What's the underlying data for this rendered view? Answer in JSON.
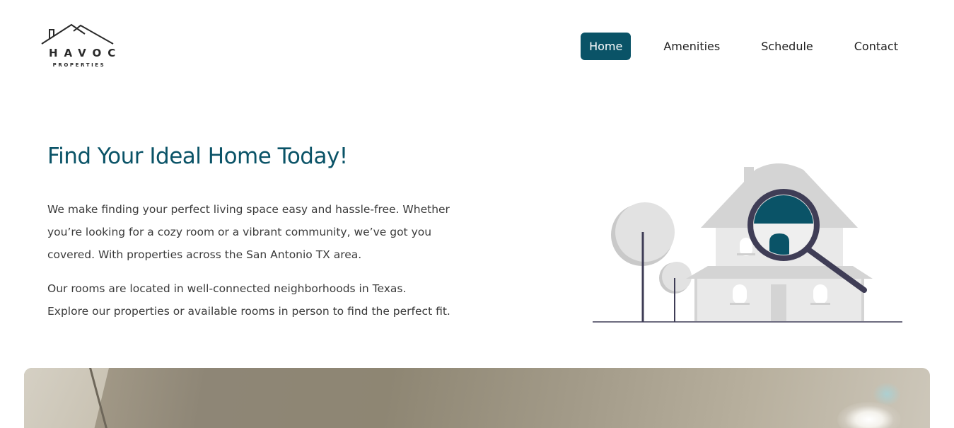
{
  "brand": {
    "name": "HAVOC",
    "subtitle": "PROPERTIES"
  },
  "nav": {
    "items": [
      {
        "label": "Home",
        "active": true
      },
      {
        "label": "Amenities",
        "active": false
      },
      {
        "label": "Schedule",
        "active": false
      },
      {
        "label": "Contact",
        "active": false
      }
    ]
  },
  "hero": {
    "title": "Find Your Ideal Home Today!",
    "paragraph_1": "We make finding your perfect living space easy and hassle-free. Whether you’re looking for a cozy room or a vibrant community, we’ve got you covered. With properties across the San Antonio TX area.",
    "paragraph_2": "Our rooms are located in well-connected neighborhoods in Texas. Explore our properties or available rooms in person to find the perfect fit."
  },
  "colors": {
    "accent": "#0a5367",
    "illustration_gray": "#d4d4d4",
    "illustration_dark": "#3f3d56"
  },
  "icons": {
    "illustration": "house-search-illustration",
    "logo_roof": "house-roof-icon"
  }
}
